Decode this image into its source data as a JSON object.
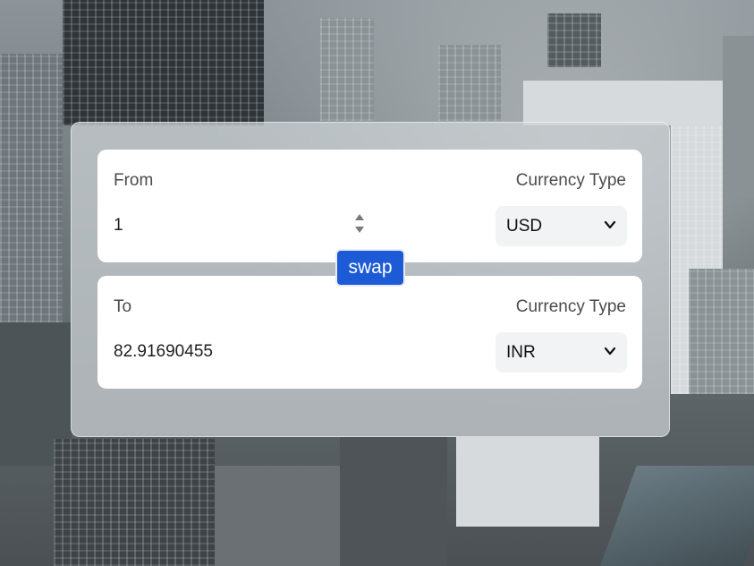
{
  "from": {
    "label": "From",
    "currency_type_label": "Currency Type",
    "amount": "1",
    "currency": "USD"
  },
  "swap": {
    "label": "swap"
  },
  "to": {
    "label": "To",
    "currency_type_label": "Currency Type",
    "amount": "82.91690455",
    "currency": "INR"
  },
  "colors": {
    "swap_button": "#1d5bd6",
    "card_background": "#ffffff",
    "select_background": "#f2f3f5"
  }
}
